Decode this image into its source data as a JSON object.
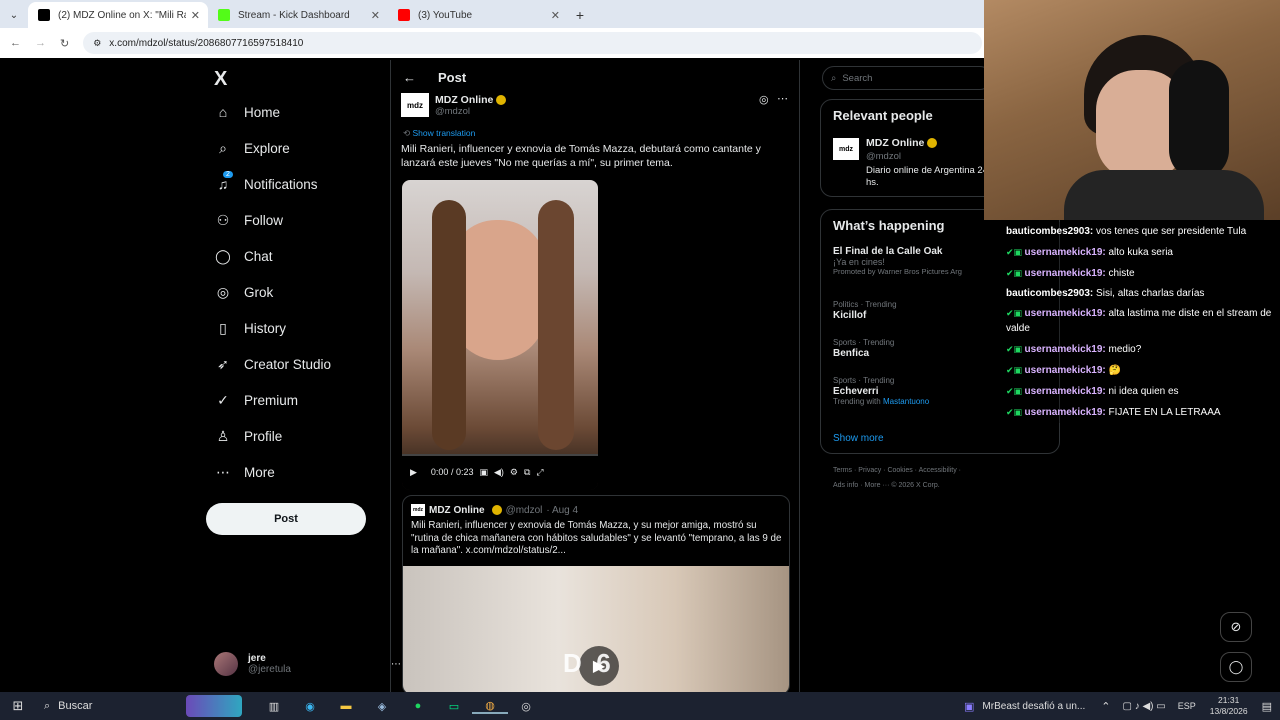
{
  "browser": {
    "tabs": [
      {
        "title": "(2) MDZ Online on X: \"Mili Rani",
        "active": true,
        "fav": "#000"
      },
      {
        "title": "Stream - Kick Dashboard",
        "active": false,
        "fav": "#53fc18"
      },
      {
        "title": "(3) YouTube",
        "active": false,
        "fav": "#ff0000"
      }
    ],
    "url": "x.com/mdzol/status/2086807716597518410"
  },
  "nav": {
    "logo": "X",
    "items": [
      {
        "label": "Home",
        "icon": "home-icon",
        "glyph": "⌂"
      },
      {
        "label": "Explore",
        "icon": "search-icon",
        "glyph": "⌕"
      },
      {
        "label": "Notifications",
        "icon": "bell-icon",
        "glyph": "♫"
      },
      {
        "label": "Follow",
        "icon": "person-add-icon",
        "glyph": "⚇"
      },
      {
        "label": "Chat",
        "icon": "chat-icon",
        "glyph": "◯"
      },
      {
        "label": "Grok",
        "icon": "grok-icon",
        "glyph": "◎"
      },
      {
        "label": "History",
        "icon": "bookmark-icon",
        "glyph": "▯"
      },
      {
        "label": "Creator Studio",
        "icon": "rocket-icon",
        "glyph": "➶"
      },
      {
        "label": "Premium",
        "icon": "verified-icon",
        "glyph": "✓"
      },
      {
        "label": "Profile",
        "icon": "profile-icon",
        "glyph": "♙"
      },
      {
        "label": "More",
        "icon": "more-icon",
        "glyph": "⋯"
      }
    ],
    "notif_badge": "2",
    "post_label": "Post",
    "account": {
      "name": "jere",
      "handle": "@jeretula"
    }
  },
  "feed": {
    "header": "Post",
    "author": {
      "name": "MDZ Online",
      "handle": "@mdzol",
      "logo": "mdz"
    },
    "show_translation": "Show translation",
    "text": "Mili Ranieri, influencer y exnovia de Tomás Mazza, debutará como cantante y lanzará este jueves \"No me querías a mí\", su primer tema.",
    "video_time": "0:00 / 0:23",
    "video_progress": 0,
    "quoted": {
      "name": "MDZ Online",
      "handle": "@mdzol",
      "date": "· Aug 4",
      "text": "Mili Ranieri, influencer y exnovia de Tomás Mazza, y su mejor amiga, mostró su \"rutina de chica mañanera con hábitos saludables\" y se levantó \"temprano, a las 9 de la mañana\". x.com/mdzol/status/2...",
      "overlay": "D  6"
    }
  },
  "side": {
    "search_placeholder": "Search",
    "relevant_title": "Relevant people",
    "rel_name": "MDZ Online",
    "rel_handle": "@mdzol",
    "rel_bio": "Diario online de Argentina 24 hs.",
    "happening_title": "What’s happening",
    "trends": [
      {
        "meta": "",
        "name": "El Final de la Calle Oak",
        "sub": "¡Ya en cines!",
        "promo": "Promoted by Warner Bros Pictures Arg"
      },
      {
        "meta": "Politics · Trending",
        "name": "Kicillof",
        "sub": "",
        "promo": ""
      },
      {
        "meta": "Sports · Trending",
        "name": "Benfica",
        "sub": "",
        "promo": ""
      },
      {
        "meta": "Sports · Trending",
        "name": "Echeverri",
        "sub": "Trending with ",
        "promo": "Mastantuono"
      }
    ],
    "show_more": "Show more",
    "footer1": "Terms · Privacy · Cookies · Accessibility ·",
    "footer2": "Ads info · More ··· © 2026 X Corp."
  },
  "chat": [
    {
      "user": "bauticombes2903:",
      "msg": "vos tenes que ser presidente Tula",
      "badge": false
    },
    {
      "user": "usernamekick19:",
      "msg": "alto kuka seria",
      "badge": true
    },
    {
      "user": "usernamekick19:",
      "msg": "chiste",
      "badge": true
    },
    {
      "user": "bauticombes2903:",
      "msg": "Sisi, altas charlas darías",
      "badge": false
    },
    {
      "user": "usernamekick19:",
      "msg": "alta lastima me diste en el stream de valde",
      "badge": true
    },
    {
      "user": "usernamekick19:",
      "msg": "medio?",
      "badge": true
    },
    {
      "user": "usernamekick19:",
      "msg": "🤔",
      "badge": true
    },
    {
      "user": "usernamekick19:",
      "msg": "ni idea quien es",
      "badge": true
    },
    {
      "user": "usernamekick19:",
      "msg": "FIJATE EN LA LETRAAA",
      "badge": true
    }
  ],
  "taskbar": {
    "search": "Buscar",
    "news": "MrBeast desafió a un...",
    "lang": "ESP",
    "time": "21:31",
    "date": "13/8/2026"
  }
}
